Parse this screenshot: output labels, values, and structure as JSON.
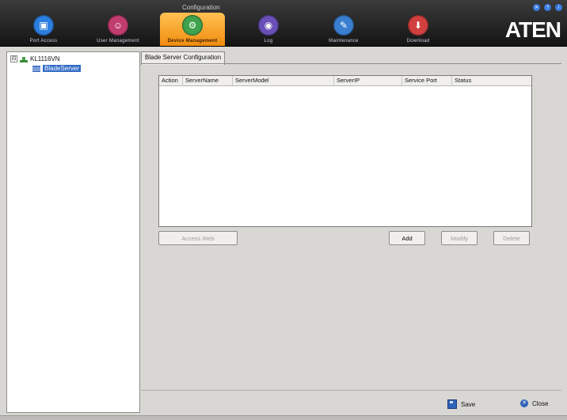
{
  "header": {
    "breadcrumb": "Configuration",
    "brand": "ATEN",
    "nav": [
      {
        "label": "Port Access",
        "icon": "port-access-icon"
      },
      {
        "label": "User Management",
        "icon": "user-management-icon"
      },
      {
        "label": "Device Management",
        "icon": "device-management-icon",
        "active": true
      },
      {
        "label": "Log",
        "icon": "log-icon"
      },
      {
        "label": "Maintenance",
        "icon": "maintenance-icon"
      },
      {
        "label": "Download",
        "icon": "download-icon"
      }
    ]
  },
  "tree": {
    "root": {
      "label": "KL1116VN",
      "expander": "⊟"
    },
    "child": {
      "label": "BladeServer"
    }
  },
  "main": {
    "tab": "Blade Server Configuration",
    "columns": [
      "Action",
      "ServerName",
      "ServerModel",
      "ServerIP",
      "Service Port",
      "Status"
    ],
    "buttons": {
      "access_web": "Access Web",
      "add": "Add",
      "modify": "Modify",
      "delete": "Delete"
    }
  },
  "footer": {
    "save": "Save",
    "close": "Close"
  },
  "colors": {
    "accent": "#f5a023",
    "selection": "#316ac5",
    "toolbar": "#1e1e1e"
  }
}
